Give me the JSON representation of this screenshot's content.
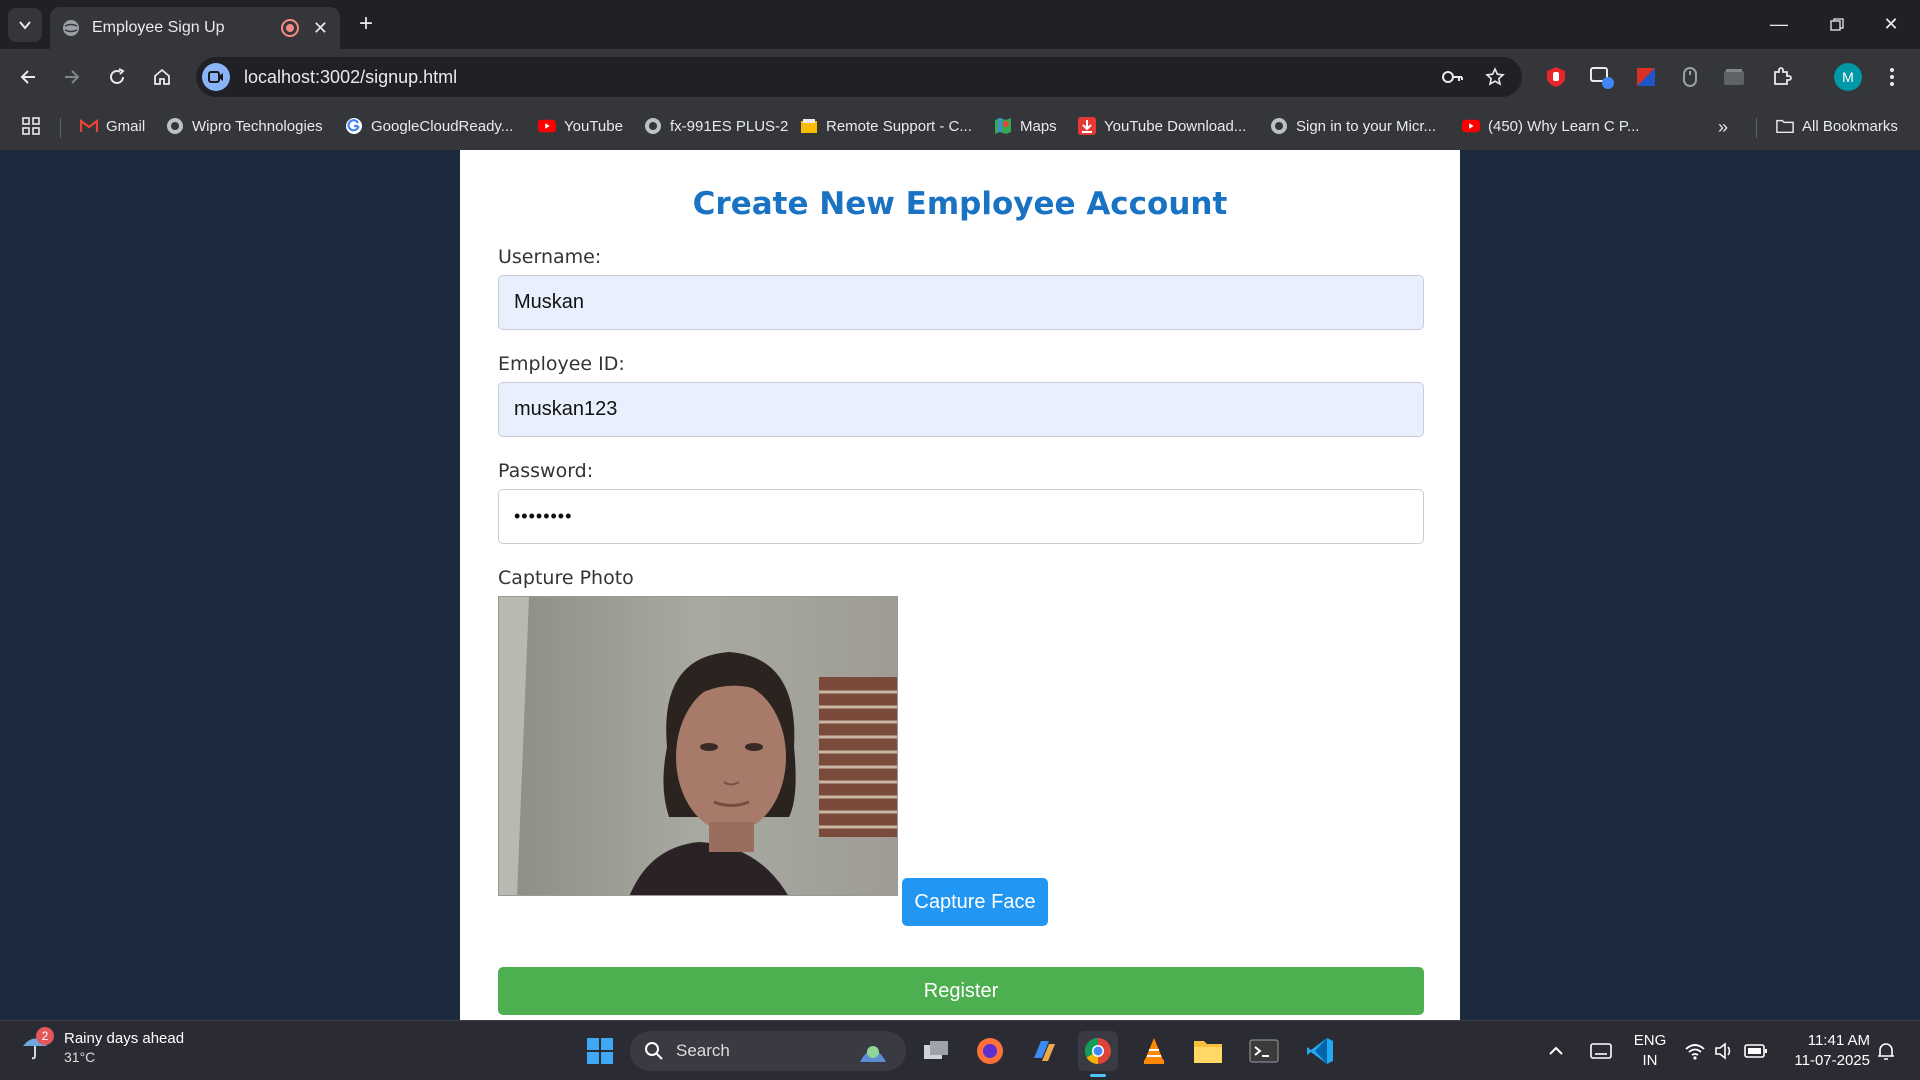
{
  "browser": {
    "tab_title": "Employee Sign Up",
    "url": "localhost:3002/signup.html",
    "profile_initial": "M",
    "bookmarks": [
      {
        "label": "Gmail",
        "icon": "gmail-icon"
      },
      {
        "label": "Wipro Technologies",
        "icon": "globe-icon"
      },
      {
        "label": "GoogleCloudReady...",
        "icon": "google-icon"
      },
      {
        "label": "YouTube",
        "icon": "youtube-icon"
      },
      {
        "label": "fx-991ES PLUS-2",
        "icon": "globe-icon"
      },
      {
        "label": "Remote Support - C...",
        "icon": "remote-icon"
      },
      {
        "label": "Maps",
        "icon": "maps-icon"
      },
      {
        "label": "YouTube Download...",
        "icon": "download-icon"
      },
      {
        "label": "Sign in to your Micr...",
        "icon": "globe-icon"
      },
      {
        "label": "(450) Why Learn C P...",
        "icon": "youtube-icon"
      }
    ],
    "all_bookmarks_label": "All Bookmarks"
  },
  "form": {
    "heading": "Create New Employee Account",
    "username_label": "Username:",
    "username_value": "Muskan",
    "employee_id_label": "Employee ID:",
    "employee_id_value": "muskan123",
    "password_label": "Password:",
    "password_value": "••••••••",
    "capture_label": "Capture Photo",
    "capture_button": "Capture Face",
    "register_button": "Register"
  },
  "taskbar": {
    "weather_title": "Rainy days ahead",
    "weather_temp": "31°C",
    "weather_badge": "2",
    "search_label": "Search",
    "lang_line1": "ENG",
    "lang_line2": "IN",
    "time": "11:41 AM",
    "date": "11-07-2025"
  },
  "colors": {
    "page_bg": "#1c2a3e",
    "heading": "#1a73c2",
    "capture_button": "#2196f3",
    "register_button": "#4caf50",
    "autofill_bg": "#e8f0fe"
  }
}
